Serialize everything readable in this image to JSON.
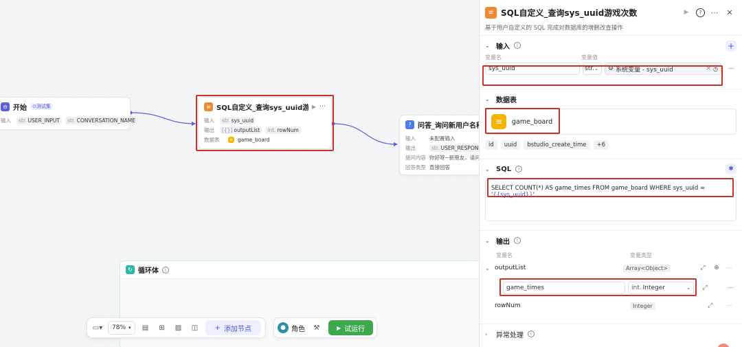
{
  "canvas": {
    "start_node": {
      "title": "开始",
      "badge": "⊙测试集",
      "row_label": "输入",
      "vars": [
        {
          "type": "str.",
          "name": "USER_INPUT"
        },
        {
          "type": "str.",
          "name": "CONVERSATION_NAME"
        }
      ]
    },
    "sql_node": {
      "title": "SQL自定义_查询sys_uuid游戏...",
      "rows": [
        {
          "label": "输入",
          "vars": [
            {
              "type": "str.",
              "name": "sys_uuid"
            }
          ]
        },
        {
          "label": "输出",
          "vars": [
            {
              "type": "[{}]",
              "name": "outputList"
            },
            {
              "type": "int.",
              "name": "rowNum"
            }
          ]
        },
        {
          "label": "数据表",
          "vars": [
            {
              "type": "",
              "name": "game_board"
            }
          ]
        }
      ]
    },
    "qa_node": {
      "title": "问答_询问新用户名称",
      "rows": [
        {
          "label": "输入",
          "text": "未配置输入"
        },
        {
          "label": "输出",
          "text": "USER_RESPONSE",
          "type": "str."
        },
        {
          "label": "提问内容",
          "text": "你好呀~新朋友，请问怎"
        },
        {
          "label": "回答类型",
          "text": "直接回答"
        }
      ]
    },
    "loop": {
      "title": "循环体"
    },
    "toolbar": {
      "zoom": "78%",
      "add_node": "添加节点",
      "role": "角色",
      "run": "试运行"
    }
  },
  "panel": {
    "title": "SQL自定义_查询sys_uuid游戏次数",
    "description": "基于用户自定义的 SQL 完成对数据库的增删改查操作",
    "input": {
      "label": "输入",
      "col_name": "变量名",
      "col_value": "变量值",
      "name_value": "sys_uuid",
      "type_short": "str.",
      "value_text": "系统变量 - sys_uuid"
    },
    "datatable": {
      "label": "数据表",
      "table_name": "game_board",
      "fields": [
        "id",
        "uuid",
        "bstudio_create_time",
        "+6"
      ]
    },
    "sql": {
      "label": "SQL",
      "query_prefix": "SELECT COUNT(*) AS game_times FROM game_board WHERE sys_uuid = '",
      "query_var": "{{sys_uuid}}",
      "query_suffix": "'"
    },
    "output": {
      "label": "输出",
      "col_name": "变量名",
      "col_type": "变量类型",
      "rows": [
        {
          "name": "outputList",
          "type": "Array<Object>"
        },
        {
          "name": "game_times",
          "type_short": "int.",
          "type": "Integer"
        },
        {
          "name": "rowNum",
          "type": "Integer"
        }
      ]
    },
    "error": {
      "label": "异常处理"
    }
  },
  "colors": {
    "accent": "#4d53e8",
    "highlight": "#c8312a",
    "run": "#3ea84d",
    "db": "#f5b400"
  }
}
